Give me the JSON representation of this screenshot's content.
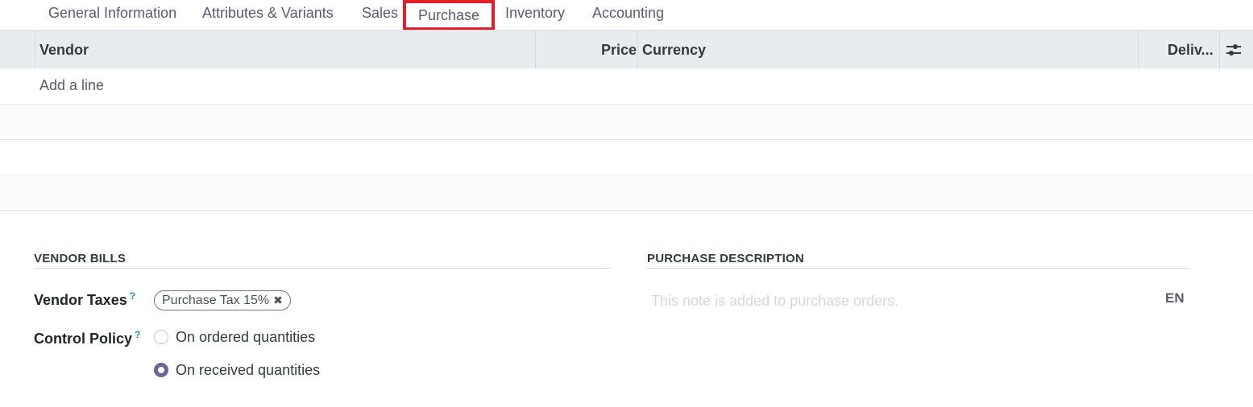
{
  "tabs": [
    {
      "label": "General Information"
    },
    {
      "label": "Attributes & Variants"
    },
    {
      "label": "Sales"
    },
    {
      "label": "Purchase",
      "highlighted": true
    },
    {
      "label": "Inventory"
    },
    {
      "label": "Accounting"
    }
  ],
  "table": {
    "columns": [
      "Vendor",
      "Price",
      "Currency",
      "Deliv..."
    ],
    "add_line": "Add a line",
    "settings_icon": "sliders-icon"
  },
  "vendor_bills": {
    "title": "VENDOR BILLS",
    "vendor_taxes_label": "Vendor Taxes",
    "tax_tag": "Purchase Tax 15%",
    "tax_tag_remove_icon": "✖",
    "control_policy_label": "Control Policy",
    "help_mark": "?",
    "options": [
      {
        "label": "On ordered quantities",
        "checked": false
      },
      {
        "label": "On received quantities",
        "checked": true
      }
    ]
  },
  "purchase_description": {
    "title": "PURCHASE DESCRIPTION",
    "placeholder": "This note is added to purchase orders.",
    "language": "EN"
  },
  "colors": {
    "highlight_box": "#e0202a",
    "accent": "#71639e",
    "header_bg": "#e9ecef"
  }
}
